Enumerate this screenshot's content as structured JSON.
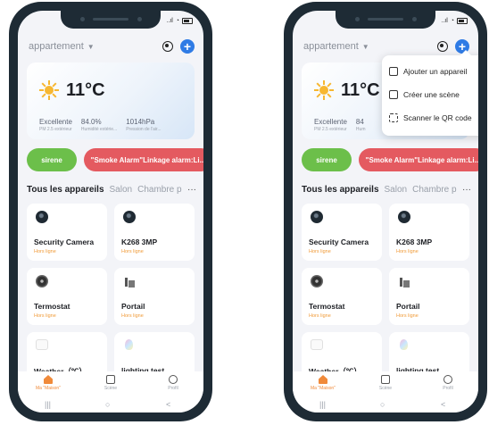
{
  "phones": [
    {
      "status_signal": "..ıl",
      "home_name": "appartement",
      "weather": {
        "temp": "11°C",
        "stats": [
          {
            "value": "Excellente",
            "label": "PM 2.5 extérieur"
          },
          {
            "value": "84.0%",
            "label": "Humidité extérie..."
          },
          {
            "value": "1014hPa",
            "label": "Pression de l'air..."
          }
        ]
      },
      "scenes": [
        {
          "label": "sirene"
        },
        {
          "label": "\"Smoke Alarm\"Linkage alarm:Li..."
        }
      ],
      "tabs": [
        "Tous les appareils",
        "Salon",
        "Chambre p",
        "···"
      ],
      "devices": [
        {
          "name": "Security Camera",
          "status": "Hors ligne",
          "icon": "camera-icon"
        },
        {
          "name": "K268 3MP",
          "status": "Hors ligne",
          "icon": "camera-icon"
        },
        {
          "name": "Termostat",
          "status": "Hors ligne",
          "icon": "thermostat-icon"
        },
        {
          "name": "Portail",
          "status": "Hors ligne",
          "icon": "gate-icon"
        },
        {
          "name": "Weather（℃）",
          "status": "",
          "icon": "weather-station-icon"
        },
        {
          "name": "lighting test",
          "status": "",
          "icon": "bulb-icon"
        }
      ],
      "bottom_nav": [
        {
          "label": "Ma \"Maison\"",
          "icon": "home-icon",
          "active": true
        },
        {
          "label": "Scène",
          "icon": "scene-icon",
          "active": false
        },
        {
          "label": "Profil",
          "icon": "profile-icon",
          "active": false
        }
      ],
      "system_nav": [
        "|||",
        "○",
        "<"
      ]
    },
    {
      "status_signal": "..ıl",
      "home_name": "appartement",
      "weather": {
        "temp": "11°C",
        "stats": [
          {
            "value": "Excellente",
            "label": "PM 2.5 extérieur"
          },
          {
            "value": "84",
            "label": "Hum"
          }
        ]
      },
      "scenes": [
        {
          "label": "sirene"
        },
        {
          "label": "\"Smoke Alarm\"Linkage alarm:Li..."
        }
      ],
      "tabs": [
        "Tous les appareils",
        "Salon",
        "Chambre p",
        "···"
      ],
      "devices": [
        {
          "name": "Security Camera",
          "status": "Hors ligne",
          "icon": "camera-icon"
        },
        {
          "name": "K268 3MP",
          "status": "Hors ligne",
          "icon": "camera-icon"
        },
        {
          "name": "Termostat",
          "status": "Hors ligne",
          "icon": "thermostat-icon"
        },
        {
          "name": "Portail",
          "status": "Hors ligne",
          "icon": "gate-icon"
        },
        {
          "name": "Weather（℃）",
          "status": "",
          "icon": "weather-station-icon"
        },
        {
          "name": "lighting test",
          "status": "",
          "icon": "bulb-icon"
        }
      ],
      "bottom_nav": [
        {
          "label": "Ma \"Maison\"",
          "icon": "home-icon",
          "active": true
        },
        {
          "label": "Scène",
          "icon": "scene-icon",
          "active": false
        },
        {
          "label": "Profil",
          "icon": "profile-icon",
          "active": false
        }
      ],
      "system_nav": [
        "|||",
        "○",
        "<"
      ],
      "menu": [
        {
          "label": "Ajouter un appareil",
          "icon": "add-device-icon"
        },
        {
          "label": "Créer une scène",
          "icon": "create-scene-icon"
        },
        {
          "label": "Scanner le QR code",
          "icon": "scan-icon"
        }
      ]
    }
  ],
  "colors": {
    "accent": "#2f7be5",
    "scene_green": "#6cbf4a",
    "scene_red": "#e45a60",
    "offline": "#f09a37",
    "active_nav": "#f08a3a"
  }
}
